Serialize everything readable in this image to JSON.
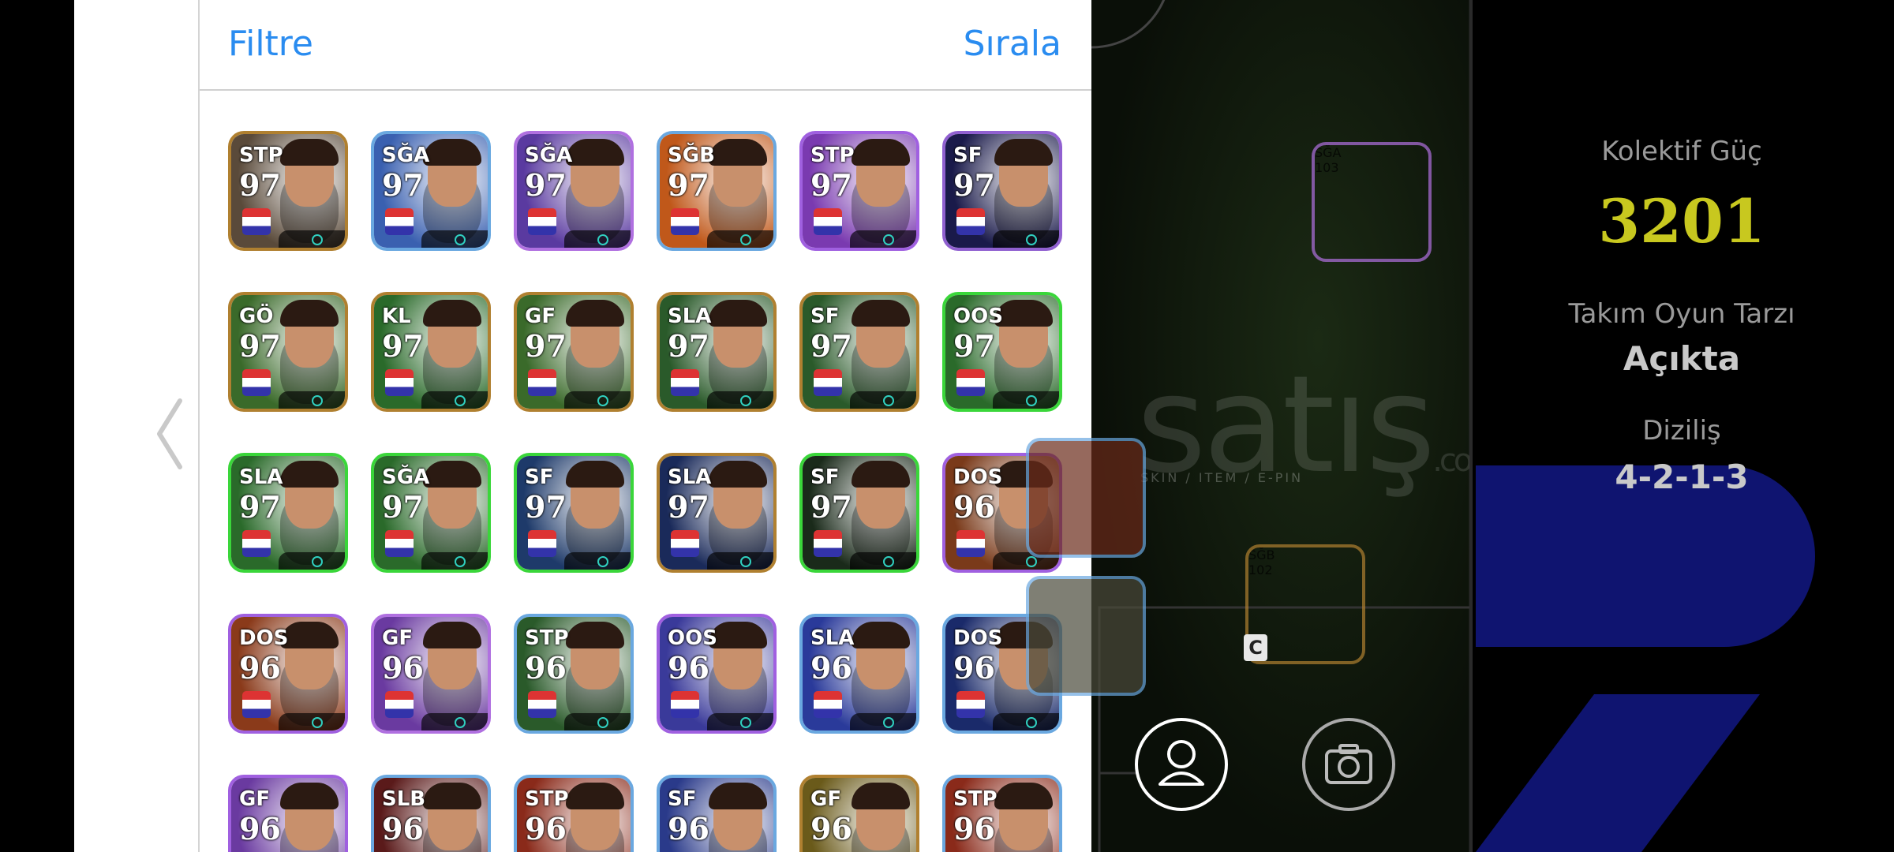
{
  "header": {
    "filter_label": "Filtre",
    "sort_label": "Sırala"
  },
  "players": [
    {
      "pos": "STP",
      "rating": "97",
      "frame": "#b08030",
      "bg": "#5a4a3a"
    },
    {
      "pos": "SĞA",
      "rating": "97",
      "frame": "#6aa8e0",
      "bg": "#3a60b0"
    },
    {
      "pos": "SĞA",
      "rating": "97",
      "frame": "#b070e0",
      "bg": "#5a3aa0"
    },
    {
      "pos": "SĞB",
      "rating": "97",
      "frame": "#6aa8e0",
      "bg": "#c0581a"
    },
    {
      "pos": "STP",
      "rating": "97",
      "frame": "#a060e0",
      "bg": "#7a3ab0"
    },
    {
      "pos": "SF",
      "rating": "97",
      "frame": "#9060d0",
      "bg": "#1a1a4a"
    },
    {
      "pos": "GÖ",
      "rating": "97",
      "frame": "#b08030",
      "bg": "#3a6a2a"
    },
    {
      "pos": "KL",
      "rating": "97",
      "frame": "#b08030",
      "bg": "#2a6a2a"
    },
    {
      "pos": "GF",
      "rating": "97",
      "frame": "#b08030",
      "bg": "#3a6a2a"
    },
    {
      "pos": "SLA",
      "rating": "97",
      "frame": "#b08030",
      "bg": "#2a5a2a"
    },
    {
      "pos": "SF",
      "rating": "97",
      "frame": "#b08030",
      "bg": "#2a5a2a"
    },
    {
      "pos": "OOS",
      "rating": "97",
      "frame": "#3ad63a",
      "bg": "#2a6a2a"
    },
    {
      "pos": "SLA",
      "rating": "97",
      "frame": "#3ad63a",
      "bg": "#2a6a2a"
    },
    {
      "pos": "SĞA",
      "rating": "97",
      "frame": "#3ad63a",
      "bg": "#2a6a2a"
    },
    {
      "pos": "SF",
      "rating": "97",
      "frame": "#3ad63a",
      "bg": "#1e3a6a"
    },
    {
      "pos": "SLA",
      "rating": "97",
      "frame": "#b08030",
      "bg": "#1a2a5a"
    },
    {
      "pos": "SF",
      "rating": "97",
      "frame": "#3ad63a",
      "bg": "#1a2a1a"
    },
    {
      "pos": "DOS",
      "rating": "96",
      "frame": "#a060e0",
      "bg": "#7a3a1a"
    },
    {
      "pos": "DOS",
      "rating": "96",
      "frame": "#a060e0",
      "bg": "#8a3a1a"
    },
    {
      "pos": "GF",
      "rating": "96",
      "frame": "#b070e0",
      "bg": "#6a3aa0"
    },
    {
      "pos": "STP",
      "rating": "96",
      "frame": "#6aa8e0",
      "bg": "#2a5a2a"
    },
    {
      "pos": "OOS",
      "rating": "96",
      "frame": "#a060e0",
      "bg": "#3a3a9a"
    },
    {
      "pos": "SLA",
      "rating": "96",
      "frame": "#6aa8e0",
      "bg": "#2a3a9a"
    },
    {
      "pos": "DOS",
      "rating": "96",
      "frame": "#6aa8e0",
      "bg": "#1a2a6a"
    },
    {
      "pos": "GF",
      "rating": "96",
      "frame": "#a060e0",
      "bg": "#6a3aa0"
    },
    {
      "pos": "SLB",
      "rating": "96",
      "frame": "#6aa8e0",
      "bg": "#5a1a1a"
    },
    {
      "pos": "STP",
      "rating": "96",
      "frame": "#6aa8e0",
      "bg": "#8a2a1a"
    },
    {
      "pos": "SF",
      "rating": "96",
      "frame": "#6aa8e0",
      "bg": "#2a3a8a"
    },
    {
      "pos": "GF",
      "rating": "96",
      "frame": "#b08030",
      "bg": "#6a5a1a"
    },
    {
      "pos": "STP",
      "rating": "96",
      "frame": "#6aa8e0",
      "bg": "#8a2a1a"
    }
  ],
  "pitch": {
    "watermark": "satış",
    "watermark_sub": "SKIN / ITEM / E-PIN",
    "watermark_com": ".com",
    "cards": [
      {
        "pos": "SĞA",
        "rating": "103",
        "frame": "#b070e0",
        "bg": "#5a1a3a"
      },
      {
        "pos": "SĞB",
        "rating": "102",
        "frame": "#b08030",
        "bg": "#6a6a1a"
      }
    ],
    "captain_label": "C"
  },
  "stats": {
    "collective_label": "Kolektif Güç",
    "collective_value": "3201",
    "style_label": "Takım Oyun Tarzı",
    "style_value": "Açıkta",
    "formation_label": "Diziliş",
    "formation_value": "4-2-1-3"
  },
  "colors": {
    "accent_blue": "#2a8cf0",
    "collective_yellow": "#c8c81f",
    "right_blue": "#0f1470"
  }
}
